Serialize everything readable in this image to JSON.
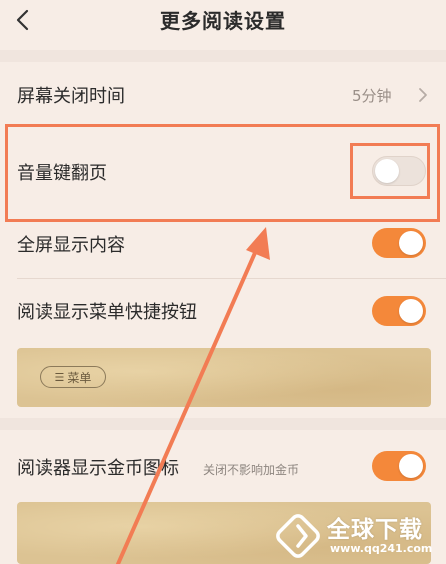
{
  "header": {
    "title": "更多阅读设置"
  },
  "settings": {
    "screen_off": {
      "label": "屏幕关闭时间",
      "value": "5分钟"
    },
    "volume_page": {
      "label": "音量键翻页",
      "enabled": false
    },
    "fullscreen": {
      "label": "全屏显示内容",
      "enabled": true
    },
    "menu_shortcut": {
      "label": "阅读显示菜单快捷按钮",
      "enabled": true,
      "preview_button": "菜单"
    },
    "coin_icon": {
      "label": "阅读器显示金币图标",
      "hint": "关闭不影响加金币",
      "enabled": true
    }
  },
  "watermark": {
    "title": "全球下载",
    "url": "www.qq241.com"
  },
  "colors": {
    "accent": "#f4883a",
    "highlight": "#f27c54",
    "background": "#f7ede6"
  }
}
